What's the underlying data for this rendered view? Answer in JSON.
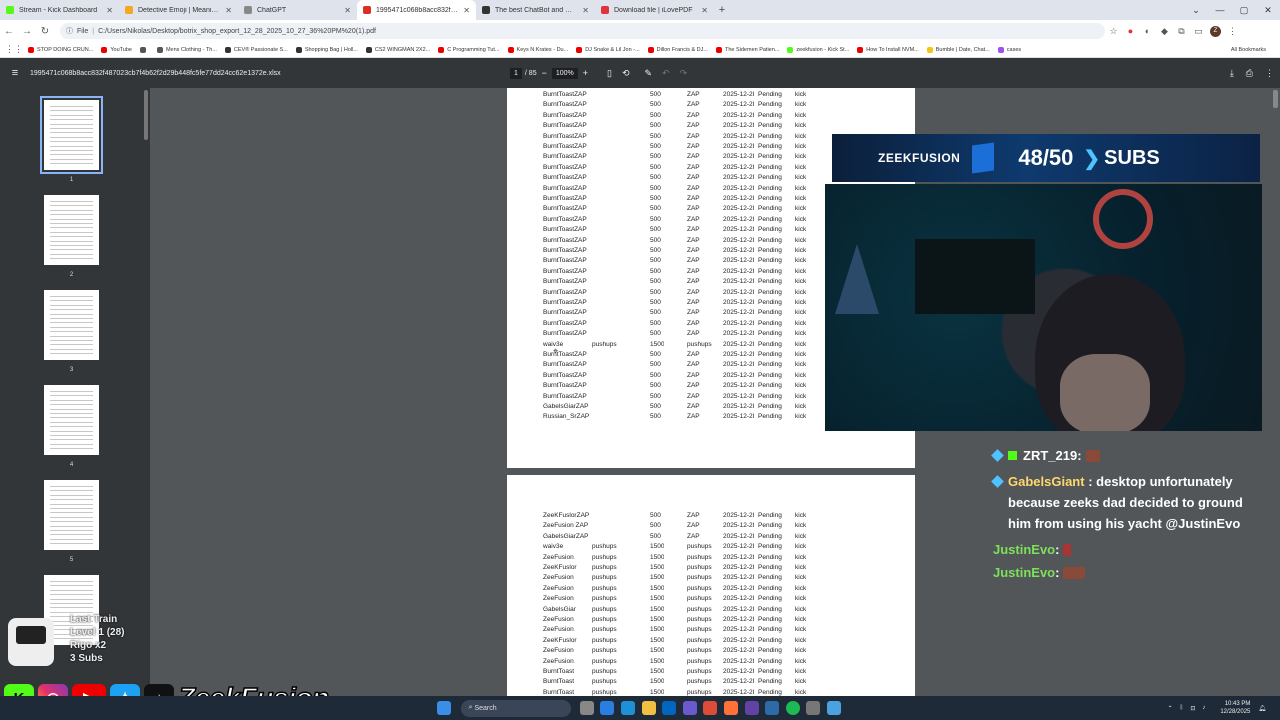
{
  "browser": {
    "tabs": [
      {
        "title": "Stream - Kick Dashboard",
        "color": "#53fc18"
      },
      {
        "title": "Detective Emoji | Meaning...",
        "color": "#f5a623"
      },
      {
        "title": "ChatGPT",
        "color": "#888888"
      },
      {
        "title": "1995471c068b8acc832f487023...",
        "color": "#d93025",
        "active": true
      },
      {
        "title": "The best ChatBot and Widgets...",
        "color": "#333333"
      },
      {
        "title": "Download file | iLovePDF",
        "color": "#e0333c"
      }
    ],
    "new_tab": "+",
    "address_scheme": "File",
    "address": "C:/Users/Nikolas/Desktop/botrix_shop_export_12_28_2025_10_27_36%20PM%20(1).pdf",
    "profile_initial": "Z",
    "bookmarks": [
      {
        "label": "STOP DOING CRUN...",
        "color": "#e00"
      },
      {
        "label": "YouTube",
        "color": "#e00"
      },
      {
        "label": "",
        "color": "#555"
      },
      {
        "label": "Mens Clothing - Th...",
        "color": "#555"
      },
      {
        "label": "CEV® Passionate S...",
        "color": "#333"
      },
      {
        "label": "Shopping Bag | Holl...",
        "color": "#333"
      },
      {
        "label": "CS2 WINGMAN 2X2...",
        "color": "#333"
      },
      {
        "label": "C Programming Tut...",
        "color": "#e00"
      },
      {
        "label": "Keys N Krates - Du...",
        "color": "#e00"
      },
      {
        "label": "DJ Snake & Lil Jon -...",
        "color": "#e00"
      },
      {
        "label": "Dillon Francis & DJ...",
        "color": "#e00"
      },
      {
        "label": "The Sidemen Patien...",
        "color": "#e00"
      },
      {
        "label": "zeekfusion - Kick St...",
        "color": "#53fc18"
      },
      {
        "label": "How To Install NVM...",
        "color": "#e00"
      },
      {
        "label": "Bumble | Date, Chat...",
        "color": "#f5c518"
      },
      {
        "label": "cases",
        "color": "#a050f0"
      }
    ],
    "all_bookmarks": "All Bookmarks"
  },
  "pdf": {
    "filename": "1995471c068b8acc832f487023cb7f4b62f2d29b448fc5fe77dd24cc62e1372e.xlsx",
    "page_current": "1",
    "page_total": "/ 85",
    "zoom": "100%",
    "thumbnails": [
      "1",
      "2",
      "3",
      "4",
      "5",
      "6"
    ],
    "page1_rows": [
      [
        "BurntToastZAP",
        "",
        "500",
        "ZAP",
        "2025-12-2I",
        "Pending",
        "kick"
      ],
      [
        "BurntToastZAP",
        "",
        "500",
        "ZAP",
        "2025-12-2I",
        "Pending",
        "kick"
      ],
      [
        "BurntToastZAP",
        "",
        "500",
        "ZAP",
        "2025-12-2I",
        "Pending",
        "kick"
      ],
      [
        "BurntToastZAP",
        "",
        "500",
        "ZAP",
        "2025-12-2I",
        "Pending",
        "kick"
      ],
      [
        "BurntToastZAP",
        "",
        "500",
        "ZAP",
        "2025-12-2I",
        "Pending",
        "kick"
      ],
      [
        "BurntToastZAP",
        "",
        "500",
        "ZAP",
        "2025-12-2I",
        "Pending",
        "kick"
      ],
      [
        "BurntToastZAP",
        "",
        "500",
        "ZAP",
        "2025-12-2I",
        "Pending",
        "kick"
      ],
      [
        "BurntToastZAP",
        "",
        "500",
        "ZAP",
        "2025-12-2I",
        "Pending",
        "kick"
      ],
      [
        "BurntToastZAP",
        "",
        "500",
        "ZAP",
        "2025-12-2I",
        "Pending",
        "kick"
      ],
      [
        "BurntToastZAP",
        "",
        "500",
        "ZAP",
        "2025-12-2I",
        "Pending",
        "kick"
      ],
      [
        "BurntToastZAP",
        "",
        "500",
        "ZAP",
        "2025-12-2I",
        "Pending",
        "kick"
      ],
      [
        "BurntToastZAP",
        "",
        "500",
        "ZAP",
        "2025-12-2I",
        "Pending",
        "kick"
      ],
      [
        "BurntToastZAP",
        "",
        "500",
        "ZAP",
        "2025-12-2I",
        "Pending",
        "kick"
      ],
      [
        "BurntToastZAP",
        "",
        "500",
        "ZAP",
        "2025-12-2I",
        "Pending",
        "kick"
      ],
      [
        "BurntToastZAP",
        "",
        "500",
        "ZAP",
        "2025-12-2I",
        "Pending",
        "kick"
      ],
      [
        "BurntToastZAP",
        "",
        "500",
        "ZAP",
        "2025-12-2I",
        "Pending",
        "kick"
      ],
      [
        "BurntToastZAP",
        "",
        "500",
        "ZAP",
        "2025-12-2I",
        "Pending",
        "kick"
      ],
      [
        "BurntToastZAP",
        "",
        "500",
        "ZAP",
        "2025-12-2I",
        "Pending",
        "kick"
      ],
      [
        "BurntToastZAP",
        "",
        "500",
        "ZAP",
        "2025-12-2I",
        "Pending",
        "kick"
      ],
      [
        "BurntToastZAP",
        "",
        "500",
        "ZAP",
        "2025-12-2I",
        "Pending",
        "kick"
      ],
      [
        "BurntToastZAP",
        "",
        "500",
        "ZAP",
        "2025-12-2I",
        "Pending",
        "kick"
      ],
      [
        "BurntToastZAP",
        "",
        "500",
        "ZAP",
        "2025-12-2I",
        "Pending",
        "kick"
      ],
      [
        "BurntToastZAP",
        "",
        "500",
        "ZAP",
        "2025-12-2I",
        "Pending",
        "kick"
      ],
      [
        "BurntToastZAP",
        "",
        "500",
        "ZAP",
        "2025-12-2I",
        "Pending",
        "kick"
      ],
      [
        "waiv3e",
        "pushups",
        "1500",
        "pushups",
        "2025-12-2I",
        "Pending",
        "kick"
      ],
      [
        "BurntToastZAP",
        "",
        "500",
        "ZAP",
        "2025-12-2I",
        "Pending",
        "kick"
      ],
      [
        "BurntToastZAP",
        "",
        "500",
        "ZAP",
        "2025-12-2I",
        "Pending",
        "kick"
      ],
      [
        "BurntToastZAP",
        "",
        "500",
        "ZAP",
        "2025-12-2I",
        "Pending",
        "kick"
      ],
      [
        "BurntToastZAP",
        "",
        "500",
        "ZAP",
        "2025-12-2I",
        "Pending",
        "kick"
      ],
      [
        "BurntToastZAP",
        "",
        "500",
        "ZAP",
        "2025-12-2I",
        "Pending",
        "kick"
      ],
      [
        "GabelsGiarZAP",
        "",
        "500",
        "ZAP",
        "2025-12-2I",
        "Pending",
        "kick"
      ],
      [
        "Russian_SrZAP",
        "",
        "500",
        "ZAP",
        "2025-12-2I",
        "Pending",
        "kick"
      ]
    ],
    "page2_rows": [
      [
        "ZeeKFuslorZAP",
        "",
        "500",
        "ZAP",
        "2025-12-2I",
        "Pending",
        "kick"
      ],
      [
        "ZeeFusion ZAP",
        "",
        "500",
        "ZAP",
        "2025-12-2I",
        "Pending",
        "kick"
      ],
      [
        "GabelsGiarZAP",
        "",
        "500",
        "ZAP",
        "2025-12-2I",
        "Pending",
        "kick"
      ],
      [
        "waiv3e",
        "pushups",
        "1500",
        "pushups",
        "2025-12-2I",
        "Pending",
        "kick"
      ],
      [
        "ZeeFusion",
        "pushups",
        "1500",
        "pushups",
        "2025-12-2I",
        "Pending",
        "kick"
      ],
      [
        "ZeeKFuslor",
        "pushups",
        "1500",
        "pushups",
        "2025-12-2I",
        "Pending",
        "kick"
      ],
      [
        "ZeeFusion",
        "pushups",
        "1500",
        "pushups",
        "2025-12-2I",
        "Pending",
        "kick"
      ],
      [
        "ZeeFusion",
        "pushups",
        "1500",
        "pushups",
        "2025-12-2I",
        "Pending",
        "kick"
      ],
      [
        "ZeeFusion",
        "pushups",
        "1500",
        "pushups",
        "2025-12-2I",
        "Pending",
        "kick"
      ],
      [
        "GabelsGiar",
        "pushups",
        "1500",
        "pushups",
        "2025-12-2I",
        "Pending",
        "kick"
      ],
      [
        "ZeeFusion",
        "pushups",
        "1500",
        "pushups",
        "2025-12-2I",
        "Pending",
        "kick"
      ],
      [
        "ZeeFusion",
        "pushups",
        "1500",
        "pushups",
        "2025-12-2I",
        "Pending",
        "kick"
      ],
      [
        "ZeeKFuslor",
        "pushups",
        "1500",
        "pushups",
        "2025-12-2I",
        "Pending",
        "kick"
      ],
      [
        "ZeeFusion",
        "pushups",
        "1500",
        "pushups",
        "2025-12-2I",
        "Pending",
        "kick"
      ],
      [
        "ZeeFusion",
        "pushups",
        "1500",
        "pushups",
        "2025-12-2I",
        "Pending",
        "kick"
      ],
      [
        "BurntToast",
        "pushups",
        "1500",
        "pushups",
        "2025-12-2I",
        "Pending",
        "kick"
      ],
      [
        "BurntToast",
        "pushups",
        "1500",
        "pushups",
        "2025-12-2I",
        "Pending",
        "kick"
      ],
      [
        "BurntToast",
        "pushups",
        "1500",
        "pushups",
        "2025-12-2I",
        "Pending",
        "kick"
      ]
    ]
  },
  "overlay": {
    "banner_brand": "ZEEKFUSION",
    "sub_count": "48/50",
    "sub_label": "SUBS",
    "chat": [
      {
        "user": "ZRT_219",
        "sep": " :",
        "message": ""
      },
      {
        "user": "GabelsGiant",
        "sep": " :",
        "message": "desktop unfortunately because zeeks dad decided to ground him from using his yacht @JustinEvo"
      },
      {
        "user": "JustinEvo",
        "sep": " :",
        "message": ""
      },
      {
        "user": "JustinEvo",
        "sep": " :",
        "message": ""
      }
    ],
    "last_train": {
      "title": "Last Train",
      "level": "Level 1  (28)",
      "multiplier": "Rigo x2",
      "subs": "3 Subs"
    },
    "brand_text": "ZeekFusion"
  },
  "taskbar": {
    "search_placeholder": "Search",
    "time": "10:43 PM",
    "date": "12/28/2025"
  }
}
